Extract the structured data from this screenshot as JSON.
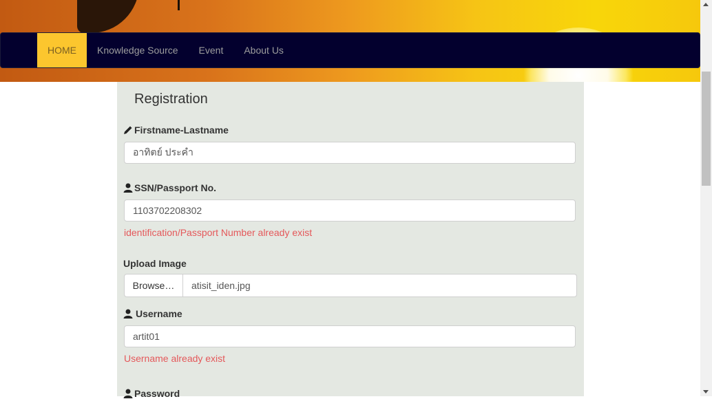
{
  "nav": {
    "items": [
      {
        "label": "HOME",
        "active": true
      },
      {
        "label": "Knowledge Source",
        "active": false
      },
      {
        "label": "Event",
        "active": false
      },
      {
        "label": "About Us",
        "active": false
      }
    ]
  },
  "form": {
    "title": "Registration",
    "fullname": {
      "label": "Firstname-Lastname",
      "value": "อาทิตย์ ประคำ",
      "icon": "pencil-icon"
    },
    "ssn": {
      "label": "SSN/Passport No.",
      "value": "1103702208302",
      "error": "identification/Passport Number already exist",
      "icon": "user-icon"
    },
    "upload": {
      "label": "Upload Image",
      "button": "Browse…",
      "filename": "atisit_iden.jpg"
    },
    "username": {
      "label": "Username",
      "value": "artit01",
      "error": "Username already exist",
      "icon": "user-icon"
    },
    "password": {
      "label": "Password",
      "icon": "user-icon"
    }
  },
  "colors": {
    "navbar_bg": "#03002e",
    "nav_active_bg": "#fcc62e",
    "panel_bg": "#e4e8e2",
    "error_text": "#e4585a"
  }
}
